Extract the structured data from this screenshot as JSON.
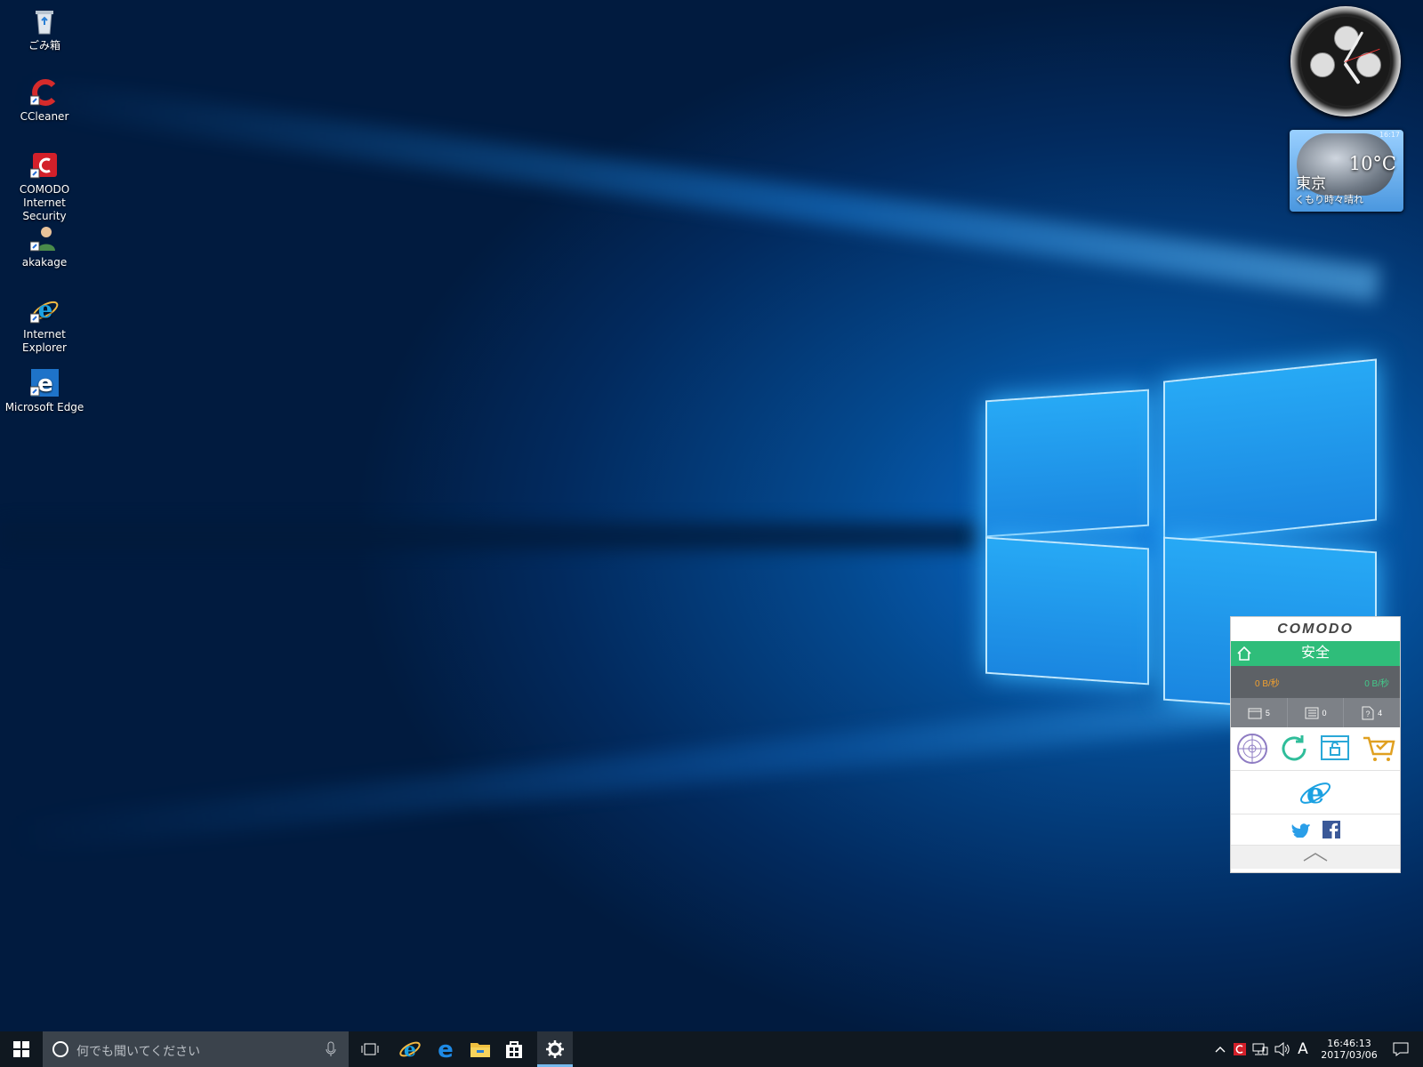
{
  "desktop": {
    "icons": [
      {
        "label": "ごみ箱",
        "icon": "recycle-bin-icon"
      },
      {
        "label": "CCleaner",
        "icon": "ccleaner-icon"
      },
      {
        "label": "COMODO Internet Security",
        "icon": "comodo-icon"
      },
      {
        "label": "akakage",
        "icon": "user-folder-icon"
      },
      {
        "label": "Internet Explorer",
        "icon": "internet-explorer-icon"
      },
      {
        "label": "Microsoft Edge",
        "icon": "edge-icon"
      }
    ]
  },
  "weather": {
    "temperature": "10°C",
    "city": "東京",
    "condition": "くもり時々晴れ",
    "time": "16:17"
  },
  "comodo": {
    "brand": "COMODO",
    "status": "安全",
    "download_rate": "0 B/秒",
    "upload_rate": "0 B/秒",
    "counts": {
      "quarantine": "5",
      "tasks": "0",
      "unknown": "4"
    },
    "colors": {
      "status": "#2fbd7a",
      "download": "#f0a030",
      "upload": "#43c98a"
    }
  },
  "taskbar": {
    "search_placeholder": "何でも聞いてください",
    "ime_mode": "A",
    "time": "16:46:13",
    "date": "2017/03/06",
    "pinned": [
      "internet-explorer-icon",
      "edge-icon",
      "file-explorer-icon",
      "store-icon",
      "settings-icon"
    ]
  }
}
